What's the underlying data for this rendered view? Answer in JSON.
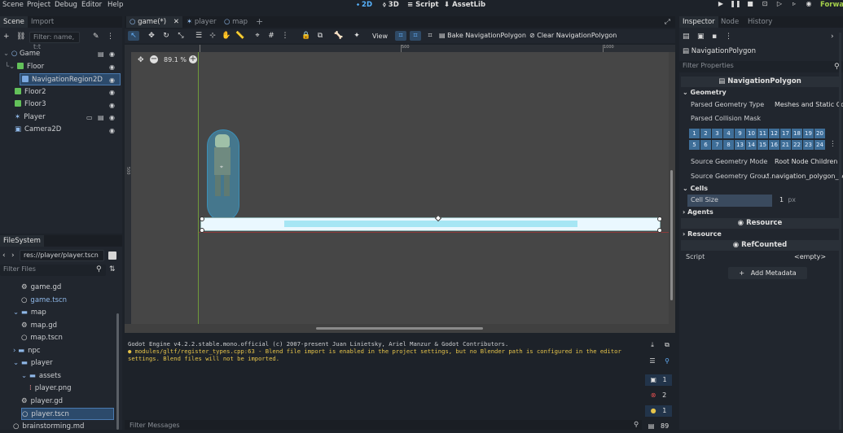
{
  "menu": [
    "Scene",
    "Project",
    "Debug",
    "Editor",
    "Help"
  ],
  "workspaces": {
    "w2d": "2D",
    "w3d": "3D",
    "script": "Script",
    "assetlib": "AssetLib"
  },
  "renderer": "Forwar",
  "scene_dock": {
    "tabs": [
      "Scene",
      "Import"
    ],
    "filter_placeholder": "Filter: name, t:t",
    "nodes": [
      {
        "name": "Game",
        "indent": 0
      },
      {
        "name": "Floor",
        "indent": 1
      },
      {
        "name": "NavigationRegion2D",
        "indent": 2
      },
      {
        "name": "Floor2",
        "indent": 1
      },
      {
        "name": "Floor3",
        "indent": 1
      },
      {
        "name": "Player",
        "indent": 1
      },
      {
        "name": "Camera2D",
        "indent": 1
      }
    ]
  },
  "filesystem": {
    "title": "FileSystem",
    "path": "res://player/player.tscn",
    "filter_placeholder": "Filter Files",
    "items": [
      {
        "name": "game.gd",
        "indent": 2
      },
      {
        "name": "game.tscn",
        "indent": 2
      },
      {
        "name": "map",
        "indent": 1
      },
      {
        "name": "map.gd",
        "indent": 2
      },
      {
        "name": "map.tscn",
        "indent": 2
      },
      {
        "name": "npc",
        "indent": 1
      },
      {
        "name": "player",
        "indent": 1
      },
      {
        "name": "assets",
        "indent": 2
      },
      {
        "name": "player.png",
        "indent": 3
      },
      {
        "name": "player.gd",
        "indent": 2
      },
      {
        "name": "player.tscn",
        "indent": 2
      },
      {
        "name": "brainstorming.md",
        "indent": 1
      }
    ]
  },
  "editor_tabs": [
    "game(*)",
    "player",
    "map"
  ],
  "toolbar": {
    "view": "View",
    "bake": "Bake NavigationPolygon",
    "clear": "Clear NavigationPolygon"
  },
  "viewport": {
    "zoom": "89.1 %",
    "ruler_500": "500",
    "ruler_1000": "1000",
    "ruler_v500": "500"
  },
  "output": {
    "lines": [
      "Godot Engine v4.2.2.stable.mono.official (c) 2007-present Juan Linietsky, Ariel Manzur & Godot Contributors.",
      "● modules/gltf/register_types.cpp:63 - Blend file import is enabled in the project settings, but no Blender path is configured in the editor",
      "settings. Blend files will not be imported."
    ],
    "filter_placeholder": "Filter Messages",
    "counts": {
      "log": "1",
      "errors": "2",
      "warnings": "1",
      "messages": "89"
    }
  },
  "inspector": {
    "tabs": [
      "Inspector",
      "Node",
      "History"
    ],
    "object": "NavigationPolygon",
    "filter_placeholder": "Filter Properties",
    "header": "NavigationPolygon",
    "geometry": "Geometry",
    "parsed_type_label": "Parsed Geometry Type",
    "parsed_type_value": "Meshes and Static Colli",
    "mask_label": "Parsed Collision Mask",
    "mask_row1": [
      "1",
      "2",
      "3",
      "4",
      "9",
      "10",
      "11",
      "12",
      "17",
      "18",
      "19",
      "20"
    ],
    "mask_row2": [
      "5",
      "6",
      "7",
      "8",
      "13",
      "14",
      "15",
      "16",
      "21",
      "22",
      "23",
      "24"
    ],
    "source_mode_label": "Source Geometry Mode",
    "source_mode_value": "Root Node Children",
    "source_group_label": "Source Geometry Grou...",
    "source_group_value": "navigation_polygon_so",
    "cells": "Cells",
    "cell_size_label": "Cell Size",
    "cell_size_value": "1",
    "cell_size_unit": "px",
    "agents": "Agents",
    "resource_head": "Resource",
    "resource": "Resource",
    "refcounted": "RefCounted",
    "script_label": "Script",
    "script_value": "<empty>",
    "add_metadata": "Add Metadata"
  }
}
